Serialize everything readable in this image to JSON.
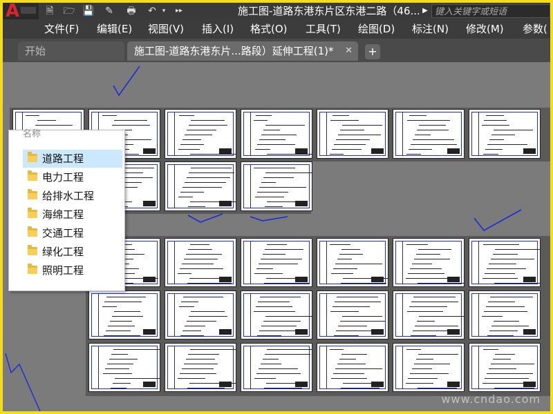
{
  "titlebar": {
    "document_title": "施工图-道路东港东片区东港二路（46...",
    "more_icon": "more-arrow-icon",
    "search_placeholder": "键入关键字或短语",
    "quick_access": [
      "new-file-icon",
      "open-folder-icon",
      "save-icon",
      "save-as-icon",
      "print-icon",
      "undo-icon",
      "undo-dropdown-icon",
      "overflow-icon"
    ]
  },
  "menubar": {
    "items": [
      "文件(F)",
      "编辑(E)",
      "视图(V)",
      "插入(I)",
      "格式(O)",
      "工具(T)",
      "绘图(D)",
      "标注(N)",
      "修改(M)",
      "参数("
    ]
  },
  "tabs": {
    "start_label": "开始",
    "active_label": "施工图-道路东港东片...路段）延伸工程(1)*",
    "close_icon": "close-icon",
    "add_icon": "plus-icon"
  },
  "popup": {
    "header": "名称",
    "folders": [
      "道路工程",
      "电力工程",
      "给排水工程",
      "海绵工程",
      "交通工程",
      "绿化工程",
      "照明工程"
    ],
    "selected_index": 0
  },
  "watermark": "www.cndao.com",
  "colors": {
    "frame": "#f2dc1c",
    "background": "#7b7b7b",
    "menubar": "#3c3c3c",
    "selected_item": "#cce8ff",
    "pen_marks": "#1b2bd6"
  }
}
